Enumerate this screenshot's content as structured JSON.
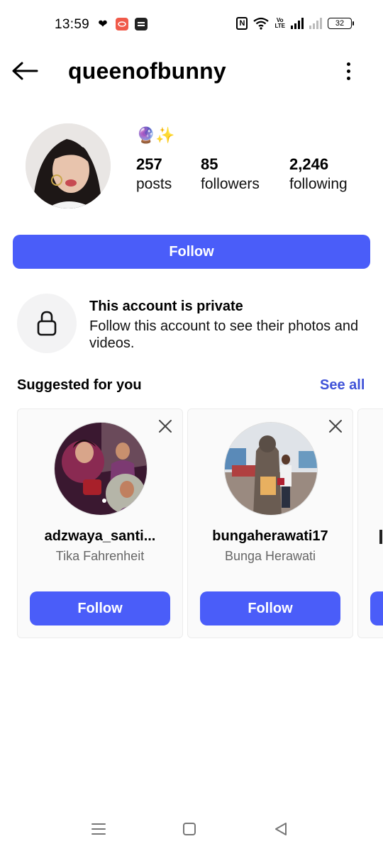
{
  "status_bar": {
    "time": "13:59",
    "battery": "32",
    "volte_top": "Vo",
    "volte_bottom": "LTE",
    "nfc": "N",
    "icons": [
      "heart-icon",
      "app-red-icon",
      "webtoon-icon",
      "nfc-icon",
      "wifi-icon",
      "volte-icon",
      "signal-icon",
      "signal-off-icon",
      "battery-icon"
    ]
  },
  "header": {
    "username": "queenofbunny"
  },
  "profile": {
    "bio": "🔮✨",
    "stats": [
      {
        "value": "257",
        "label": "posts"
      },
      {
        "value": "85",
        "label": "followers"
      },
      {
        "value": "2,246",
        "label": "following"
      }
    ],
    "follow_label": "Follow"
  },
  "private_notice": {
    "title": "This account is private",
    "description": "Follow this account to see their photos and videos."
  },
  "suggested": {
    "title": "Suggested for you",
    "see_all": "See all",
    "cards": [
      {
        "username": "adzwaya_santi...",
        "name": "Tika Fahrenheit",
        "button": "Follow"
      },
      {
        "username": "bungaherawati17",
        "name": "Bunga Herawati",
        "button": "Follow"
      }
    ]
  },
  "colors": {
    "accent": "#4a5df9",
    "link": "#3f52d8"
  }
}
